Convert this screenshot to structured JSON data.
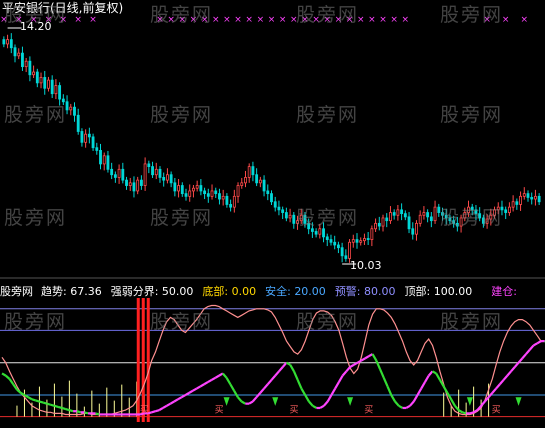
{
  "window": {
    "title": "平安银行(日线,前复权)",
    "watermark": "股旁网"
  },
  "colors": {
    "background": "#000000",
    "up_candle": "#ff4a4a",
    "down_candle": "#00d7d7",
    "trend_line": "#ff9090",
    "magenta_line": "#ff44ff",
    "green_line": "#33dd33",
    "yellow_line": "#ffff99",
    "red_bar": "#ff2020",
    "ref_line": "#7a7aff",
    "bottom_line": "#ff3030"
  },
  "main_panel": {
    "high_label": "14.20",
    "low_label": "10.03",
    "top_marker_glyph": "×"
  },
  "indicator_panel": {
    "legend": [
      {
        "key": "source",
        "label": "股旁网",
        "value": "",
        "color": "#ffffff"
      },
      {
        "key": "trend",
        "label": "趋势: ",
        "value": "67.36",
        "color": "#ffffff"
      },
      {
        "key": "strength",
        "label": "强弱分界: ",
        "value": "50.00",
        "color": "#ffffff"
      },
      {
        "key": "bottom",
        "label": "底部: ",
        "value": "0.00",
        "color": "#ffd700"
      },
      {
        "key": "safe",
        "label": "安全: ",
        "value": "20.00",
        "color": "#4aa8ff"
      },
      {
        "key": "warning",
        "label": "预警: ",
        "value": "80.00",
        "color": "#8f8fff"
      },
      {
        "key": "top",
        "label": "顶部: ",
        "value": "100.00",
        "color": "#ffffff"
      },
      {
        "key": "build",
        "label": "建仓: ",
        "value": "",
        "color": "#ff44ff"
      }
    ],
    "signal_text": "买"
  },
  "chart_data": [
    {
      "type": "candlestick",
      "title": "平安银行(日线,前复权)",
      "xlabel": "",
      "ylabel": "",
      "annotations": [
        {
          "text": "14.20",
          "at_index": 1
        },
        {
          "text": "10.03",
          "at_index": 91
        }
      ],
      "closes": [
        14.02,
        14.1,
        13.95,
        13.8,
        13.85,
        13.6,
        13.7,
        13.45,
        13.5,
        13.3,
        13.4,
        13.2,
        13.35,
        13.1,
        13.25,
        13.0,
        12.95,
        12.8,
        12.85,
        12.7,
        12.4,
        12.2,
        12.35,
        12.3,
        12.1,
        12.05,
        11.8,
        11.95,
        11.7,
        11.6,
        11.55,
        11.7,
        11.5,
        11.4,
        11.45,
        11.3,
        11.5,
        11.4,
        11.8,
        11.75,
        11.6,
        11.7,
        11.55,
        11.5,
        11.6,
        11.45,
        11.3,
        11.4,
        11.25,
        11.2,
        11.3,
        11.35,
        11.4,
        11.3,
        11.25,
        11.2,
        11.3,
        11.25,
        11.15,
        11.2,
        11.05,
        11.0,
        11.2,
        11.4,
        11.45,
        11.55,
        11.75,
        11.6,
        11.45,
        11.5,
        11.3,
        11.25,
        11.1,
        11.0,
        10.95,
        10.9,
        10.8,
        10.85,
        10.7,
        10.75,
        10.85,
        10.7,
        10.6,
        10.55,
        10.5,
        10.6,
        10.45,
        10.4,
        10.35,
        10.3,
        10.25,
        10.1,
        10.05,
        10.35,
        10.4,
        10.35,
        10.38,
        10.42,
        10.4,
        10.6,
        10.7,
        10.65,
        10.8,
        10.75,
        10.9,
        10.85,
        10.95,
        10.88,
        10.82,
        10.6,
        10.5,
        10.7,
        10.85,
        10.9,
        10.82,
        10.75,
        11.0,
        10.9,
        10.85,
        10.8,
        10.75,
        10.7,
        10.65,
        10.8,
        10.9,
        11.0,
        10.95,
        10.88,
        10.8,
        10.7,
        10.78,
        10.85,
        10.95,
        11.0,
        10.95,
        10.9,
        11.0,
        11.1,
        11.05,
        11.2,
        11.25,
        11.18,
        11.15,
        11.2,
        11.1
      ],
      "ylim": [
        9.8,
        14.5
      ]
    },
    {
      "type": "line",
      "title": "",
      "legend": [
        "趋势",
        "强弱分界",
        "底部",
        "安全",
        "预警",
        "顶部",
        "建仓"
      ],
      "reference_lines": {
        "bottom": 0,
        "safe": 20,
        "strength": 50,
        "warning": 80,
        "top": 100
      },
      "ylim": [
        -5,
        110
      ],
      "series": [
        {
          "name": "趋势",
          "color": "#ff9090",
          "values": [
            55,
            50,
            42,
            35,
            28,
            22,
            18,
            14,
            10,
            8,
            6,
            5,
            4,
            4,
            3,
            3,
            3,
            2,
            2,
            2,
            2,
            2,
            3,
            3,
            2,
            2,
            2,
            2,
            2,
            2,
            3,
            4,
            5,
            6,
            8,
            10,
            15,
            22,
            30,
            40,
            52,
            60,
            70,
            80,
            88,
            92,
            90,
            85,
            80,
            78,
            82,
            86,
            90,
            95,
            100,
            102,
            103,
            103,
            102,
            100,
            98,
            96,
            94,
            92,
            94,
            96,
            98,
            99,
            100,
            100,
            100,
            99,
            97,
            92,
            85,
            78,
            70,
            65,
            60,
            58,
            62,
            70,
            80,
            90,
            96,
            98,
            98,
            97,
            94,
            88,
            80,
            68,
            55,
            45,
            40,
            44,
            55,
            70,
            85,
            95,
            100,
            100,
            99,
            96,
            92,
            86,
            78,
            70,
            60,
            52,
            48,
            52,
            60,
            68,
            72,
            66,
            55,
            42,
            30,
            18,
            10,
            5,
            3,
            2,
            2,
            2,
            3,
            5,
            8,
            15,
            25,
            35,
            48,
            60,
            70,
            78,
            84,
            88,
            90,
            90,
            88,
            85,
            80,
            75,
            70
          ]
        },
        {
          "name": "建仓",
          "color": "#ff44ff",
          "values": [
            40,
            38,
            35,
            30,
            25,
            22,
            20,
            18,
            16,
            15,
            14,
            13,
            12,
            11,
            10,
            9,
            8,
            7,
            6,
            5,
            5,
            4,
            4,
            3,
            3,
            3,
            2,
            2,
            2,
            2,
            2,
            2,
            2,
            2,
            2,
            2,
            2,
            2,
            3,
            3,
            4,
            5,
            6,
            8,
            10,
            12,
            14,
            16,
            18,
            20,
            22,
            24,
            26,
            28,
            30,
            32,
            34,
            36,
            38,
            40,
            36,
            30,
            24,
            18,
            14,
            12,
            12,
            14,
            18,
            22,
            26,
            30,
            34,
            38,
            42,
            46,
            50,
            48,
            42,
            34,
            26,
            20,
            14,
            10,
            8,
            8,
            10,
            14,
            20,
            26,
            32,
            38,
            42,
            46,
            48,
            50,
            52,
            54,
            56,
            58,
            52,
            44,
            36,
            28,
            20,
            14,
            10,
            8,
            8,
            10,
            14,
            20,
            26,
            32,
            38,
            42,
            40,
            34,
            28,
            22,
            16,
            10,
            6,
            4,
            3,
            3,
            4,
            6,
            10,
            14,
            18,
            22,
            26,
            30,
            34,
            38,
            42,
            46,
            50,
            54,
            58,
            62,
            66,
            68,
            70,
            70,
            68
          ]
        }
      ]
    }
  ]
}
